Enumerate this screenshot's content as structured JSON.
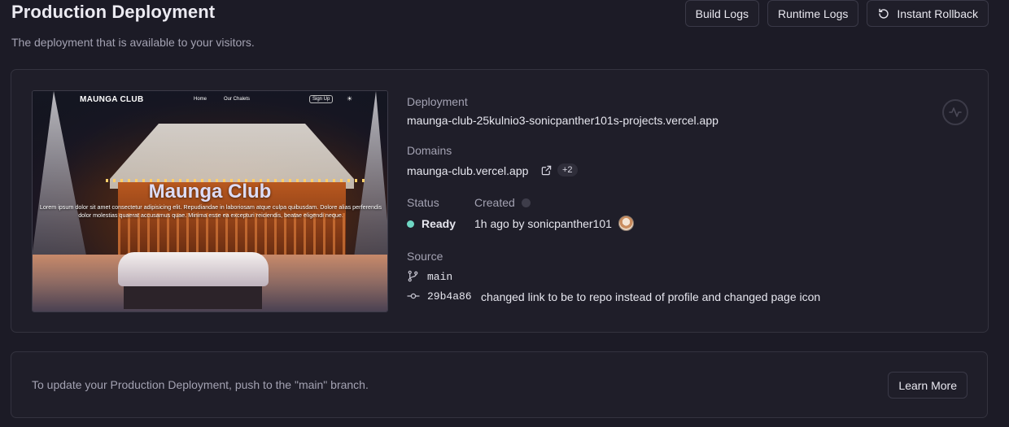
{
  "header": {
    "title": "Production Deployment",
    "subtitle": "The deployment that is available to your visitors.",
    "build_logs_label": "Build Logs",
    "runtime_logs_label": "Runtime Logs",
    "rollback_label": "Instant Rollback"
  },
  "preview": {
    "logo": "MAUNGA CLUB",
    "nav_home": "Home",
    "nav_chalets": "Our Chalets",
    "nav_signup": "Sign Up",
    "mode_icon": "☀",
    "hero_title": "Maunga Club",
    "hero_text": "Lorem ipsum dolor sit amet consectetur adipisicing elit. Repudiandae in laboriosam atque culpa quibusdam. Dolore alias perferendis dolor molestias quaerat accusamus quae. Minima esse ea excepturi reiciendis, beatae eligendi neque."
  },
  "deployment": {
    "label": "Deployment",
    "url": "maunga-club-25kulnio3-sonicpanther101s-projects.vercel.app"
  },
  "domains": {
    "label": "Domains",
    "primary": "maunga-club.vercel.app",
    "extra_count": "+2"
  },
  "status": {
    "label": "Status",
    "value": "Ready",
    "color": "#6fd7c4"
  },
  "created": {
    "label": "Created",
    "value": "1h ago by sonicpanther101"
  },
  "source": {
    "label": "Source",
    "branch": "main",
    "commit_hash": "29b4a86",
    "commit_message": "changed link to be to repo instead of profile and changed page icon"
  },
  "footer": {
    "message": "To update your Production Deployment, push to the \"main\" branch.",
    "learn_more_label": "Learn More"
  },
  "icons": [
    "rollback-icon",
    "external-link-icon",
    "info-icon",
    "avatar",
    "git-branch-icon",
    "git-commit-icon",
    "activity-icon"
  ]
}
